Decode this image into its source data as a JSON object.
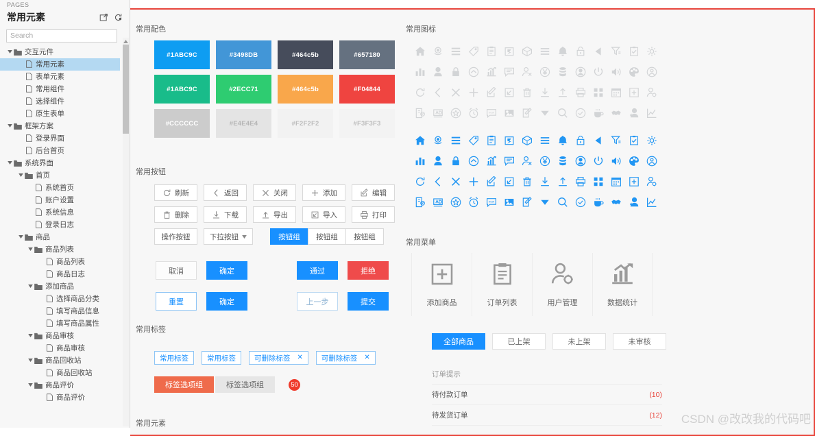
{
  "sidebar": {
    "pages_label": "PAGES",
    "title": "常用元素",
    "search_placeholder": "Search",
    "actions": [
      {
        "name": "open-in-new-icon",
        "label": "打开"
      },
      {
        "name": "reload-icon",
        "label": "刷新"
      }
    ],
    "tree": [
      {
        "label": "交互元件",
        "type": "folder",
        "depth": 0,
        "expanded": true,
        "selected": false
      },
      {
        "label": "常用元素",
        "type": "page",
        "depth": 1,
        "expanded": false,
        "selected": true
      },
      {
        "label": "表单元素",
        "type": "page",
        "depth": 1,
        "expanded": false,
        "selected": false
      },
      {
        "label": "常用组件",
        "type": "page",
        "depth": 1,
        "expanded": false,
        "selected": false
      },
      {
        "label": "选择组件",
        "type": "page",
        "depth": 1,
        "expanded": false,
        "selected": false
      },
      {
        "label": "原生表单",
        "type": "page",
        "depth": 1,
        "expanded": false,
        "selected": false
      },
      {
        "label": "框架方案",
        "type": "folder",
        "depth": 0,
        "expanded": true,
        "selected": false
      },
      {
        "label": "登录界面",
        "type": "page",
        "depth": 1,
        "expanded": false,
        "selected": false
      },
      {
        "label": "后台首页",
        "type": "page",
        "depth": 1,
        "expanded": false,
        "selected": false
      },
      {
        "label": "系统界面",
        "type": "folder",
        "depth": 0,
        "expanded": true,
        "selected": false
      },
      {
        "label": "首页",
        "type": "folder",
        "depth": 1,
        "expanded": true,
        "selected": false
      },
      {
        "label": "系统首页",
        "type": "page",
        "depth": 2,
        "expanded": false,
        "selected": false
      },
      {
        "label": "账户设置",
        "type": "page",
        "depth": 2,
        "expanded": false,
        "selected": false
      },
      {
        "label": "系统信息",
        "type": "page",
        "depth": 2,
        "expanded": false,
        "selected": false
      },
      {
        "label": "登录日志",
        "type": "page",
        "depth": 2,
        "expanded": false,
        "selected": false
      },
      {
        "label": "商品",
        "type": "folder",
        "depth": 1,
        "expanded": true,
        "selected": false
      },
      {
        "label": "商品列表",
        "type": "folder",
        "depth": 2,
        "expanded": true,
        "selected": false
      },
      {
        "label": "商品列表",
        "type": "page",
        "depth": 3,
        "expanded": false,
        "selected": false
      },
      {
        "label": "商品日志",
        "type": "page",
        "depth": 3,
        "expanded": false,
        "selected": false
      },
      {
        "label": "添加商品",
        "type": "folder",
        "depth": 2,
        "expanded": true,
        "selected": false
      },
      {
        "label": "选择商品分类",
        "type": "page",
        "depth": 3,
        "expanded": false,
        "selected": false
      },
      {
        "label": "填写商品信息",
        "type": "page",
        "depth": 3,
        "expanded": false,
        "selected": false
      },
      {
        "label": "填写商品属性",
        "type": "page",
        "depth": 3,
        "expanded": false,
        "selected": false
      },
      {
        "label": "商品审核",
        "type": "folder",
        "depth": 2,
        "expanded": true,
        "selected": false
      },
      {
        "label": "商品审核",
        "type": "page",
        "depth": 3,
        "expanded": false,
        "selected": false
      },
      {
        "label": "商品回收站",
        "type": "folder",
        "depth": 2,
        "expanded": true,
        "selected": false
      },
      {
        "label": "商品回收站",
        "type": "page",
        "depth": 3,
        "expanded": false,
        "selected": false
      },
      {
        "label": "商品评价",
        "type": "folder",
        "depth": 2,
        "expanded": true,
        "selected": false
      },
      {
        "label": "商品评价",
        "type": "page",
        "depth": 3,
        "expanded": false,
        "selected": false
      }
    ]
  },
  "canvas": {
    "border_color": "#e8453c",
    "watermark": "CSDN @改改我的代码吧",
    "palette": {
      "title": "常用配色",
      "swatches": [
        {
          "label": "#1ABC9C",
          "fill": "#0e9df2",
          "text": "#ffffff"
        },
        {
          "label": "#3498DB",
          "fill": "#4296d7",
          "text": "#ffffff"
        },
        {
          "label": "#464c5b",
          "fill": "#464c5b",
          "text": "#ffffff"
        },
        {
          "label": "#657180",
          "fill": "#657180",
          "text": "#ffffff"
        },
        {
          "label": "#1ABC9C",
          "fill": "#19bc8a",
          "text": "#ffffff"
        },
        {
          "label": "#2ECC71",
          "fill": "#2ecc71",
          "text": "#ffffff"
        },
        {
          "label": "#464c5b",
          "fill": "#f9a74b",
          "text": "#ffffff"
        },
        {
          "label": "#F04844",
          "fill": "#ef4440",
          "text": "#ffffff"
        },
        {
          "label": "#CCCCCC",
          "fill": "#cccccc",
          "text": "#ffffff"
        },
        {
          "label": "#E4E4E4",
          "fill": "#e4e4e4",
          "text": "#b5b5b5"
        },
        {
          "label": "#F2F2F2",
          "fill": "#f2f2f2",
          "text": "#bdbdbd"
        },
        {
          "label": "#F3F3F3",
          "fill": "#f3f3f3",
          "text": "#bdbdbd"
        }
      ]
    },
    "buttons": {
      "title": "常用按钮",
      "row1": [
        {
          "label": "刷新",
          "icon": "refresh-icon"
        },
        {
          "label": "返回",
          "icon": "chevron-left-icon"
        },
        {
          "label": "关闭",
          "icon": "close-icon"
        },
        {
          "label": "添加",
          "icon": "plus-icon"
        },
        {
          "label": "编辑",
          "icon": "edit-icon"
        }
      ],
      "row2": [
        {
          "label": "删除",
          "icon": "trash-icon"
        },
        {
          "label": "下载",
          "icon": "download-icon"
        },
        {
          "label": "导出",
          "icon": "upload-icon"
        },
        {
          "label": "导入",
          "icon": "import-icon"
        },
        {
          "label": "打印",
          "icon": "printer-icon"
        }
      ],
      "action_label": "操作按钮",
      "dropdown_label": "下拉按钮",
      "group": [
        {
          "label": "按钮组",
          "active": true
        },
        {
          "label": "按钮组",
          "active": false
        },
        {
          "label": "按钮组",
          "active": false
        }
      ],
      "colored_row1": [
        {
          "label": "取消",
          "style": "ghost"
        },
        {
          "label": "确定",
          "style": "blue"
        },
        {
          "label": "通过",
          "style": "blue"
        },
        {
          "label": "拒绝",
          "style": "red"
        }
      ],
      "colored_row2": [
        {
          "label": "重置",
          "style": "outline"
        },
        {
          "label": "确定",
          "style": "blue"
        },
        {
          "label": "上一步",
          "style": "outline2"
        },
        {
          "label": "提交",
          "style": "blue"
        }
      ]
    },
    "tags": {
      "title": "常用标签",
      "items": [
        {
          "label": "常用标签",
          "closable": false
        },
        {
          "label": "常用标签",
          "closable": false
        },
        {
          "label": "可删除标签",
          "closable": true
        },
        {
          "label": "可删除标签",
          "closable": true
        }
      ],
      "options": [
        {
          "label": "标签选项组",
          "active": true
        },
        {
          "label": "标签选项组",
          "active": false
        }
      ],
      "badge": "50"
    },
    "elements_title": "常用元素",
    "icons": {
      "title": "常用图标",
      "grid_gray_color": "#d2d4d6",
      "grid_blue_color": "#2196f3",
      "names": [
        "home-icon",
        "support-icon",
        "menu-lines-icon",
        "tag-icon",
        "clipboard-icon",
        "archive-icon",
        "box-icon",
        "list-icon",
        "bell-icon",
        "unlock-icon",
        "play-left-icon",
        "filter-icon",
        "checklist-icon",
        "gear-icon",
        "bar-chart-icon",
        "user-icon",
        "lock-icon",
        "cloud-icon",
        "trend-chart-icon",
        "comment-icon",
        "user-remove-icon",
        "yen-icon",
        "database-icon",
        "avatar-circle-icon",
        "power-icon",
        "volume-icon",
        "palette-icon",
        "user-circle-icon",
        "refresh-icon",
        "chevron-left-icon",
        "close-icon",
        "plus-icon",
        "edit-icon",
        "import-icon",
        "trash-icon",
        "download-icon",
        "upload-icon",
        "printer-icon",
        "grid-icon",
        "calendar-icon",
        "add-box-icon",
        "user-settings-icon",
        "mobile-pay-icon",
        "ad-icon",
        "star-circle-icon",
        "alarm-icon",
        "new-chat-icon",
        "image-icon",
        "note-edit-icon",
        "caret-down-icon",
        "search-icon",
        "check-circle-icon",
        "coffee-icon",
        "handshake-icon",
        "user-alt-icon",
        "line-chart-icon"
      ]
    },
    "menu": {
      "title": "常用菜单",
      "cards": [
        {
          "label": "添加商品",
          "icon": "add-box-icon"
        },
        {
          "label": "订单列表",
          "icon": "clipboard-icon"
        },
        {
          "label": "用户管理",
          "icon": "user-settings-icon"
        },
        {
          "label": "数据统计",
          "icon": "trend-chart-icon"
        }
      ]
    },
    "product_tabs": [
      {
        "label": "全部商品",
        "active": true
      },
      {
        "label": "已上架",
        "active": false
      },
      {
        "label": "未上架",
        "active": false
      },
      {
        "label": "未审核",
        "active": false
      }
    ],
    "orders": {
      "header": "订单提示",
      "rows": [
        {
          "label": "待付款订单",
          "count": "(10)"
        },
        {
          "label": "待发货订单",
          "count": "(12)"
        }
      ]
    }
  }
}
